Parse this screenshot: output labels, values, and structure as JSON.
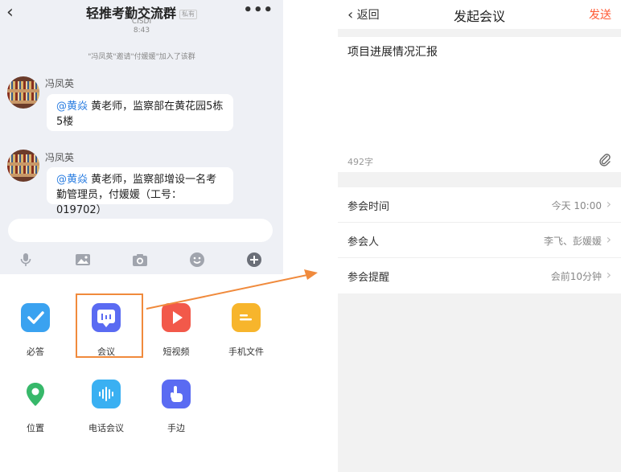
{
  "chat": {
    "back_icon": "chevron-left-icon",
    "title": "轻推考勤交流群",
    "title_tag": "私有",
    "subtitle": "CISDI",
    "time": "8:43",
    "system_message": "\"冯凤英\"邀请\"付媛媛\"加入了该群",
    "messages": [
      {
        "sender": "冯凤英",
        "mention": "@黄焱",
        "text": " 黄老师，监察部在黄花园5栋5楼"
      },
      {
        "sender": "冯凤英",
        "mention": "@黄焱",
        "text": " 黄老师，监察部增设一名考勤管理员，付媛媛（工号：019702）"
      }
    ],
    "toolbar_icons": [
      "microphone-icon",
      "image-icon",
      "camera-icon",
      "emoji-icon",
      "plus-icon"
    ],
    "apps": [
      {
        "label": "必答",
        "icon": "check-icon",
        "color": "#3aa2f0"
      },
      {
        "label": "会议",
        "icon": "meeting-icon",
        "color": "#5a6bf2"
      },
      {
        "label": "短视频",
        "icon": "play-icon",
        "color": "#f2594a"
      },
      {
        "label": "手机文件",
        "icon": "folder-icon",
        "color": "#f7b52c"
      },
      {
        "label": "位置",
        "icon": "location-pin-icon",
        "color": "#37b86a"
      },
      {
        "label": "电话会议",
        "icon": "voice-wave-icon",
        "color": "#3ab0f2"
      },
      {
        "label": "手边",
        "icon": "hand-pointer-icon",
        "color": "#5a6bf2"
      }
    ]
  },
  "meeting": {
    "back_label": "返回",
    "title": "发起会议",
    "send_label": "发送",
    "topic": "项目进展情况汇报",
    "char_count": "492字",
    "rows": [
      {
        "label": "参会时间",
        "value": "今天 10:00"
      },
      {
        "label": "参会人",
        "value": "李飞、彭媛媛"
      },
      {
        "label": "参会提醒",
        "value": "会前10分钟"
      }
    ]
  },
  "colors": {
    "accent_send": "#ff5a34",
    "highlight_box": "#f08a3c",
    "mention": "#2a7de1"
  }
}
